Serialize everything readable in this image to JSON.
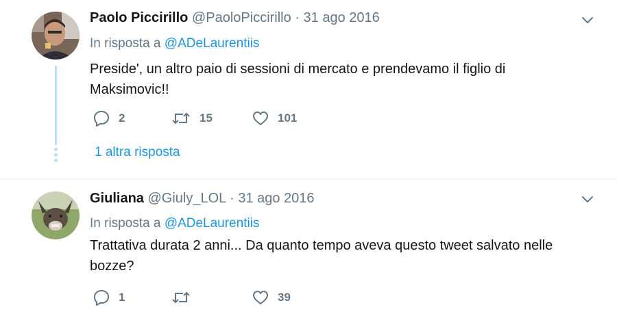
{
  "tweets": [
    {
      "name": "Paolo Piccirillo",
      "handle": "@PaoloPiccirillo",
      "separator": "·",
      "date": "31 ago 2016",
      "reply_prefix": "In risposta a",
      "reply_to": "@ADeLaurentiis",
      "text": "Preside', un altro paio di sessioni di mercato e prendevamo il figlio di Maksimovic!!",
      "replies": "2",
      "retweets": "15",
      "likes": "101",
      "more_replies": "1 altra risposta"
    },
    {
      "name": "Giuliana",
      "handle": "@Giuly_LOL",
      "separator": "·",
      "date": "31 ago 2016",
      "reply_prefix": "In risposta a",
      "reply_to": "@ADeLaurentiis",
      "text": "Trattativa durata 2 anni... Da quanto tempo aveva questo tweet salvato nelle bozze?",
      "replies": "1",
      "retweets": "",
      "likes": "39"
    }
  ],
  "icons": {
    "reply": "reply-icon",
    "retweet": "retweet-icon",
    "like": "heart-icon",
    "menu": "chevron-down-icon"
  },
  "colors": {
    "link": "#1b95e0",
    "muted": "#657786",
    "text": "#14171a",
    "thread_line": "#b6dff7"
  }
}
